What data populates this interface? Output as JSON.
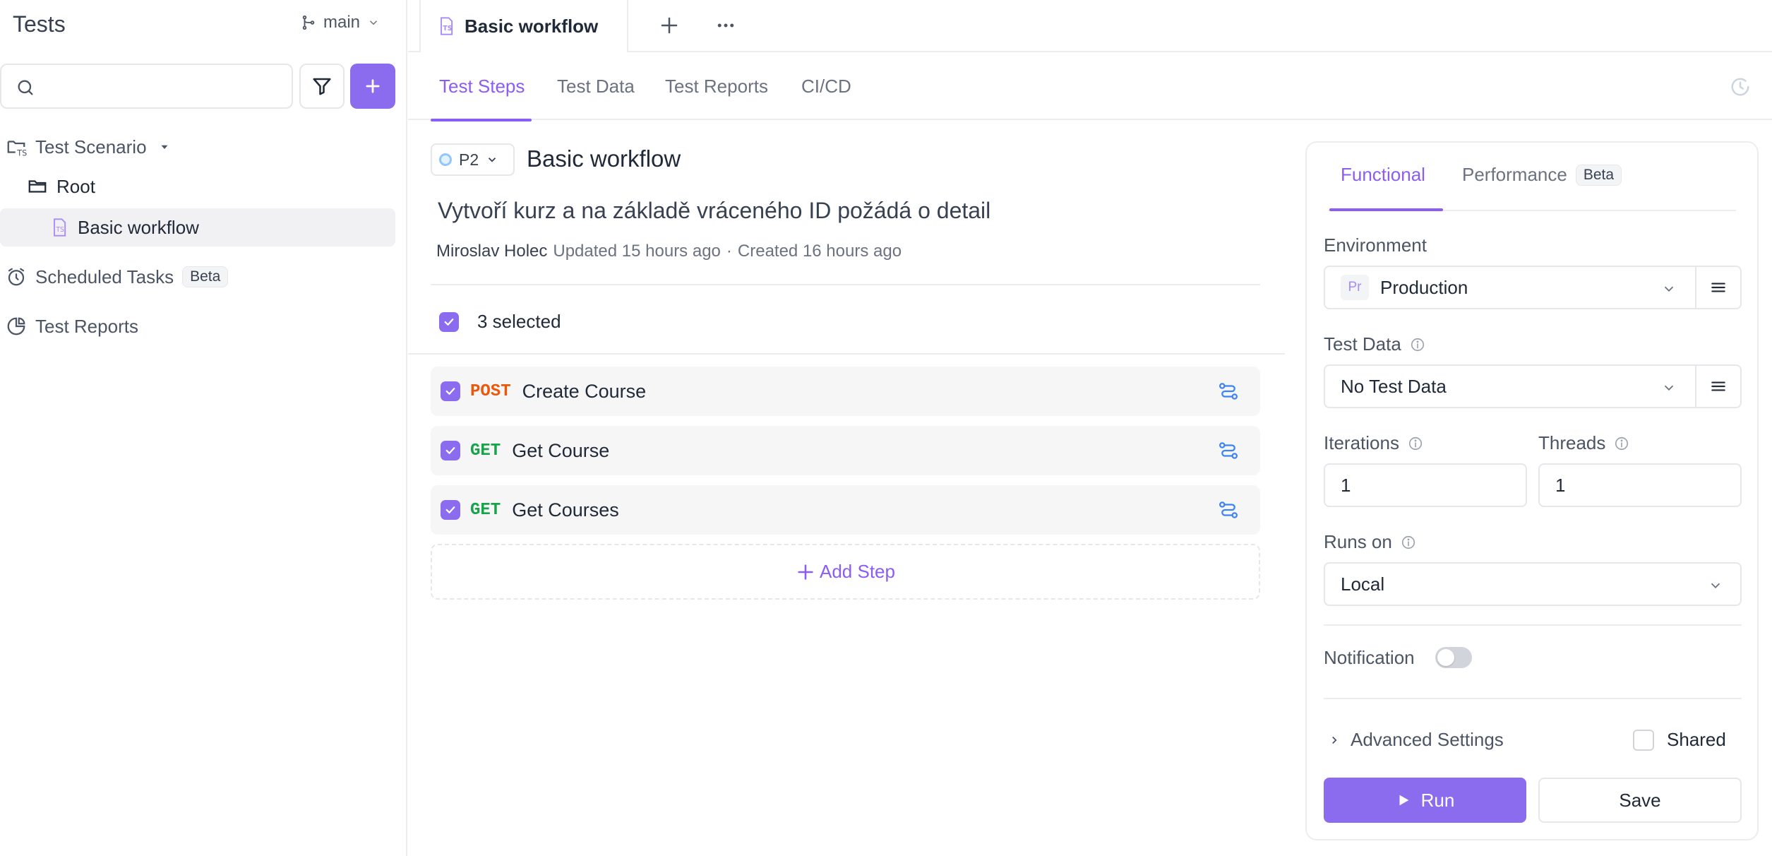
{
  "sidebar": {
    "title": "Tests",
    "branch": "main",
    "search": {
      "value": "",
      "placeholder": ""
    },
    "tree": {
      "scenario": "Test Scenario",
      "root": "Root",
      "workflow": "Basic workflow"
    },
    "scheduled_tasks": "Scheduled Tasks",
    "scheduled_badge": "Beta",
    "test_reports": "Test Reports"
  },
  "tabbar": {
    "open_tab": "Basic workflow"
  },
  "subtabs": [
    "Test Steps",
    "Test Data",
    "Test Reports",
    "CI/CD"
  ],
  "scenario": {
    "priority": "P2",
    "title": "Basic workflow",
    "description": "Vytvoří kurz a na základě vráceného ID požádá o detail",
    "author": "Miroslav Holec",
    "updated": "Updated 15 hours ago",
    "separator": "·",
    "created": "Created 16 hours ago",
    "selected": "3 selected",
    "steps": [
      {
        "method": "POST",
        "name": "Create Course"
      },
      {
        "method": "GET",
        "name": "Get Course"
      },
      {
        "method": "GET",
        "name": "Get Courses"
      }
    ],
    "add_step": "Add Step"
  },
  "panel": {
    "tabs": {
      "functional": "Functional",
      "performance": "Performance",
      "performance_badge": "Beta"
    },
    "environment_label": "Environment",
    "environment_badge": "Pr",
    "environment_value": "Production",
    "test_data_label": "Test Data",
    "test_data_value": "No Test Data",
    "iterations_label": "Iterations",
    "iterations_value": "1",
    "threads_label": "Threads",
    "threads_value": "1",
    "runs_on_label": "Runs on",
    "runs_on_value": "Local",
    "notification_label": "Notification",
    "notification_on": false,
    "advanced_label": "Advanced Settings",
    "shared_label": "Shared",
    "run_label": "Run",
    "save_label": "Save"
  },
  "colors": {
    "accent": "#8b6cef",
    "post": "#ea580c",
    "get": "#16a34a"
  }
}
